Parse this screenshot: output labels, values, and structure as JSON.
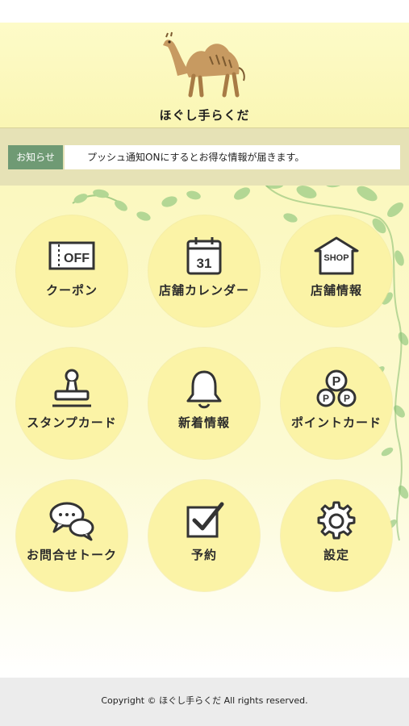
{
  "header": {
    "brand": "ほぐし手らくだ",
    "logo": "camel-logo"
  },
  "news": {
    "tag": "お知らせ",
    "text": "プッシュ通知ONにするとお得な情報が届きます。"
  },
  "menu": [
    {
      "label": "クーポン",
      "icon": "coupon-off-icon",
      "icon_text": "OFF"
    },
    {
      "label": "店舗カレンダー",
      "icon": "calendar-icon",
      "icon_text": "31"
    },
    {
      "label": "店舗情報",
      "icon": "shop-icon",
      "icon_text": "SHOP"
    },
    {
      "label": "スタンプカード",
      "icon": "stamp-icon"
    },
    {
      "label": "新着情報",
      "icon": "bell-icon"
    },
    {
      "label": "ポイントカード",
      "icon": "points-icon",
      "icon_text": "P"
    },
    {
      "label": "お問合せトーク",
      "icon": "chat-icon"
    },
    {
      "label": "予約",
      "icon": "checkbox-icon"
    },
    {
      "label": "設定",
      "icon": "gear-icon"
    }
  ],
  "footer": {
    "copyright": "Copyright © ほぐし手らくだ All rights reserved."
  },
  "colors": {
    "header_bg": "#fdfbc8",
    "tile_bg": "#fbf3a6",
    "news_tag_bg": "#6f9a74",
    "leaf": "#8cc47a"
  }
}
